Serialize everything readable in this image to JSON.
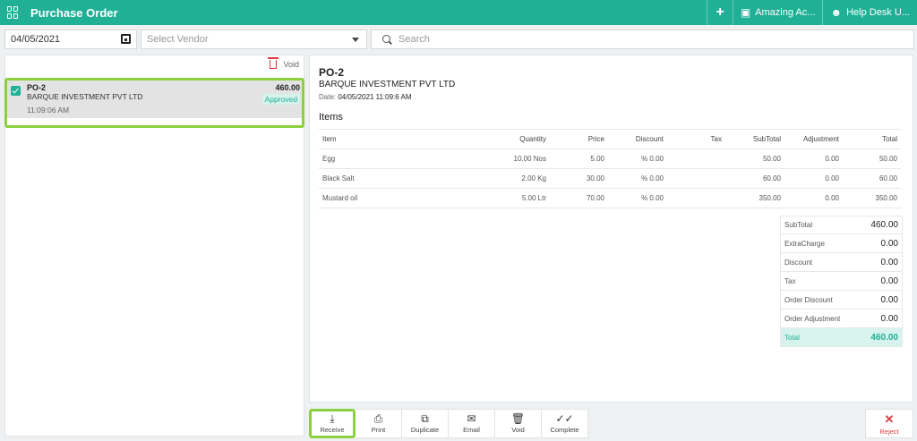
{
  "topbar": {
    "title": "Purchase Order",
    "store_label": "Amazing Ac...",
    "help_label": "Help Desk U...",
    "plus_label": "+"
  },
  "filters": {
    "date_value": "04/05/2021",
    "vendor_placeholder": "Select Vendor",
    "search_placeholder": "Search"
  },
  "list": {
    "void_label": "Void",
    "orders": [
      {
        "po": "PO-2",
        "vendor": "BARQUE INVESTMENT PVT LTD",
        "time": "11:09:06 AM",
        "amount": "460.00",
        "status": "Approved"
      }
    ]
  },
  "detail": {
    "po": "PO-2",
    "vendor": "BARQUE INVESTMENT PVT LTD",
    "date_label": "Date:",
    "date_value": "04/05/2021 11:09:6 AM",
    "items_heading": "Items",
    "columns": [
      "Item",
      "Quantity",
      "Price",
      "Discount",
      "Tax",
      "SubTotal",
      "Adjustment",
      "Total"
    ],
    "rows": [
      [
        "Egg",
        "10.00 Nos",
        "5.00",
        "% 0.00",
        "",
        "50.00",
        "0.00",
        "50.00"
      ],
      [
        "Black Salt",
        "2.00 Kg",
        "30.00",
        "% 0.00",
        "",
        "60.00",
        "0.00",
        "60.00"
      ],
      [
        "Mustard oil",
        "5.00 Ltr",
        "70.00",
        "% 0.00",
        "",
        "350.00",
        "0.00",
        "350.00"
      ]
    ],
    "totals": [
      {
        "label": "SubTotal",
        "value": "460.00"
      },
      {
        "label": "ExtraCharge",
        "value": "0.00"
      },
      {
        "label": "Discount",
        "value": "0.00"
      },
      {
        "label": "Tax",
        "value": "0.00"
      },
      {
        "label": "Order Discount",
        "value": "0.00"
      },
      {
        "label": "Order Adjustment",
        "value": "0.00"
      },
      {
        "label": "Total",
        "value": "460.00"
      }
    ]
  },
  "actions": {
    "receive": "Receive",
    "print": "Print",
    "duplicate": "Duplicate",
    "email": "Email",
    "void": "Void",
    "complete": "Complete",
    "reject": "Reject"
  },
  "colors": {
    "brand": "#1fb096",
    "highlight": "#8dd03f",
    "danger": "#e0383e"
  }
}
